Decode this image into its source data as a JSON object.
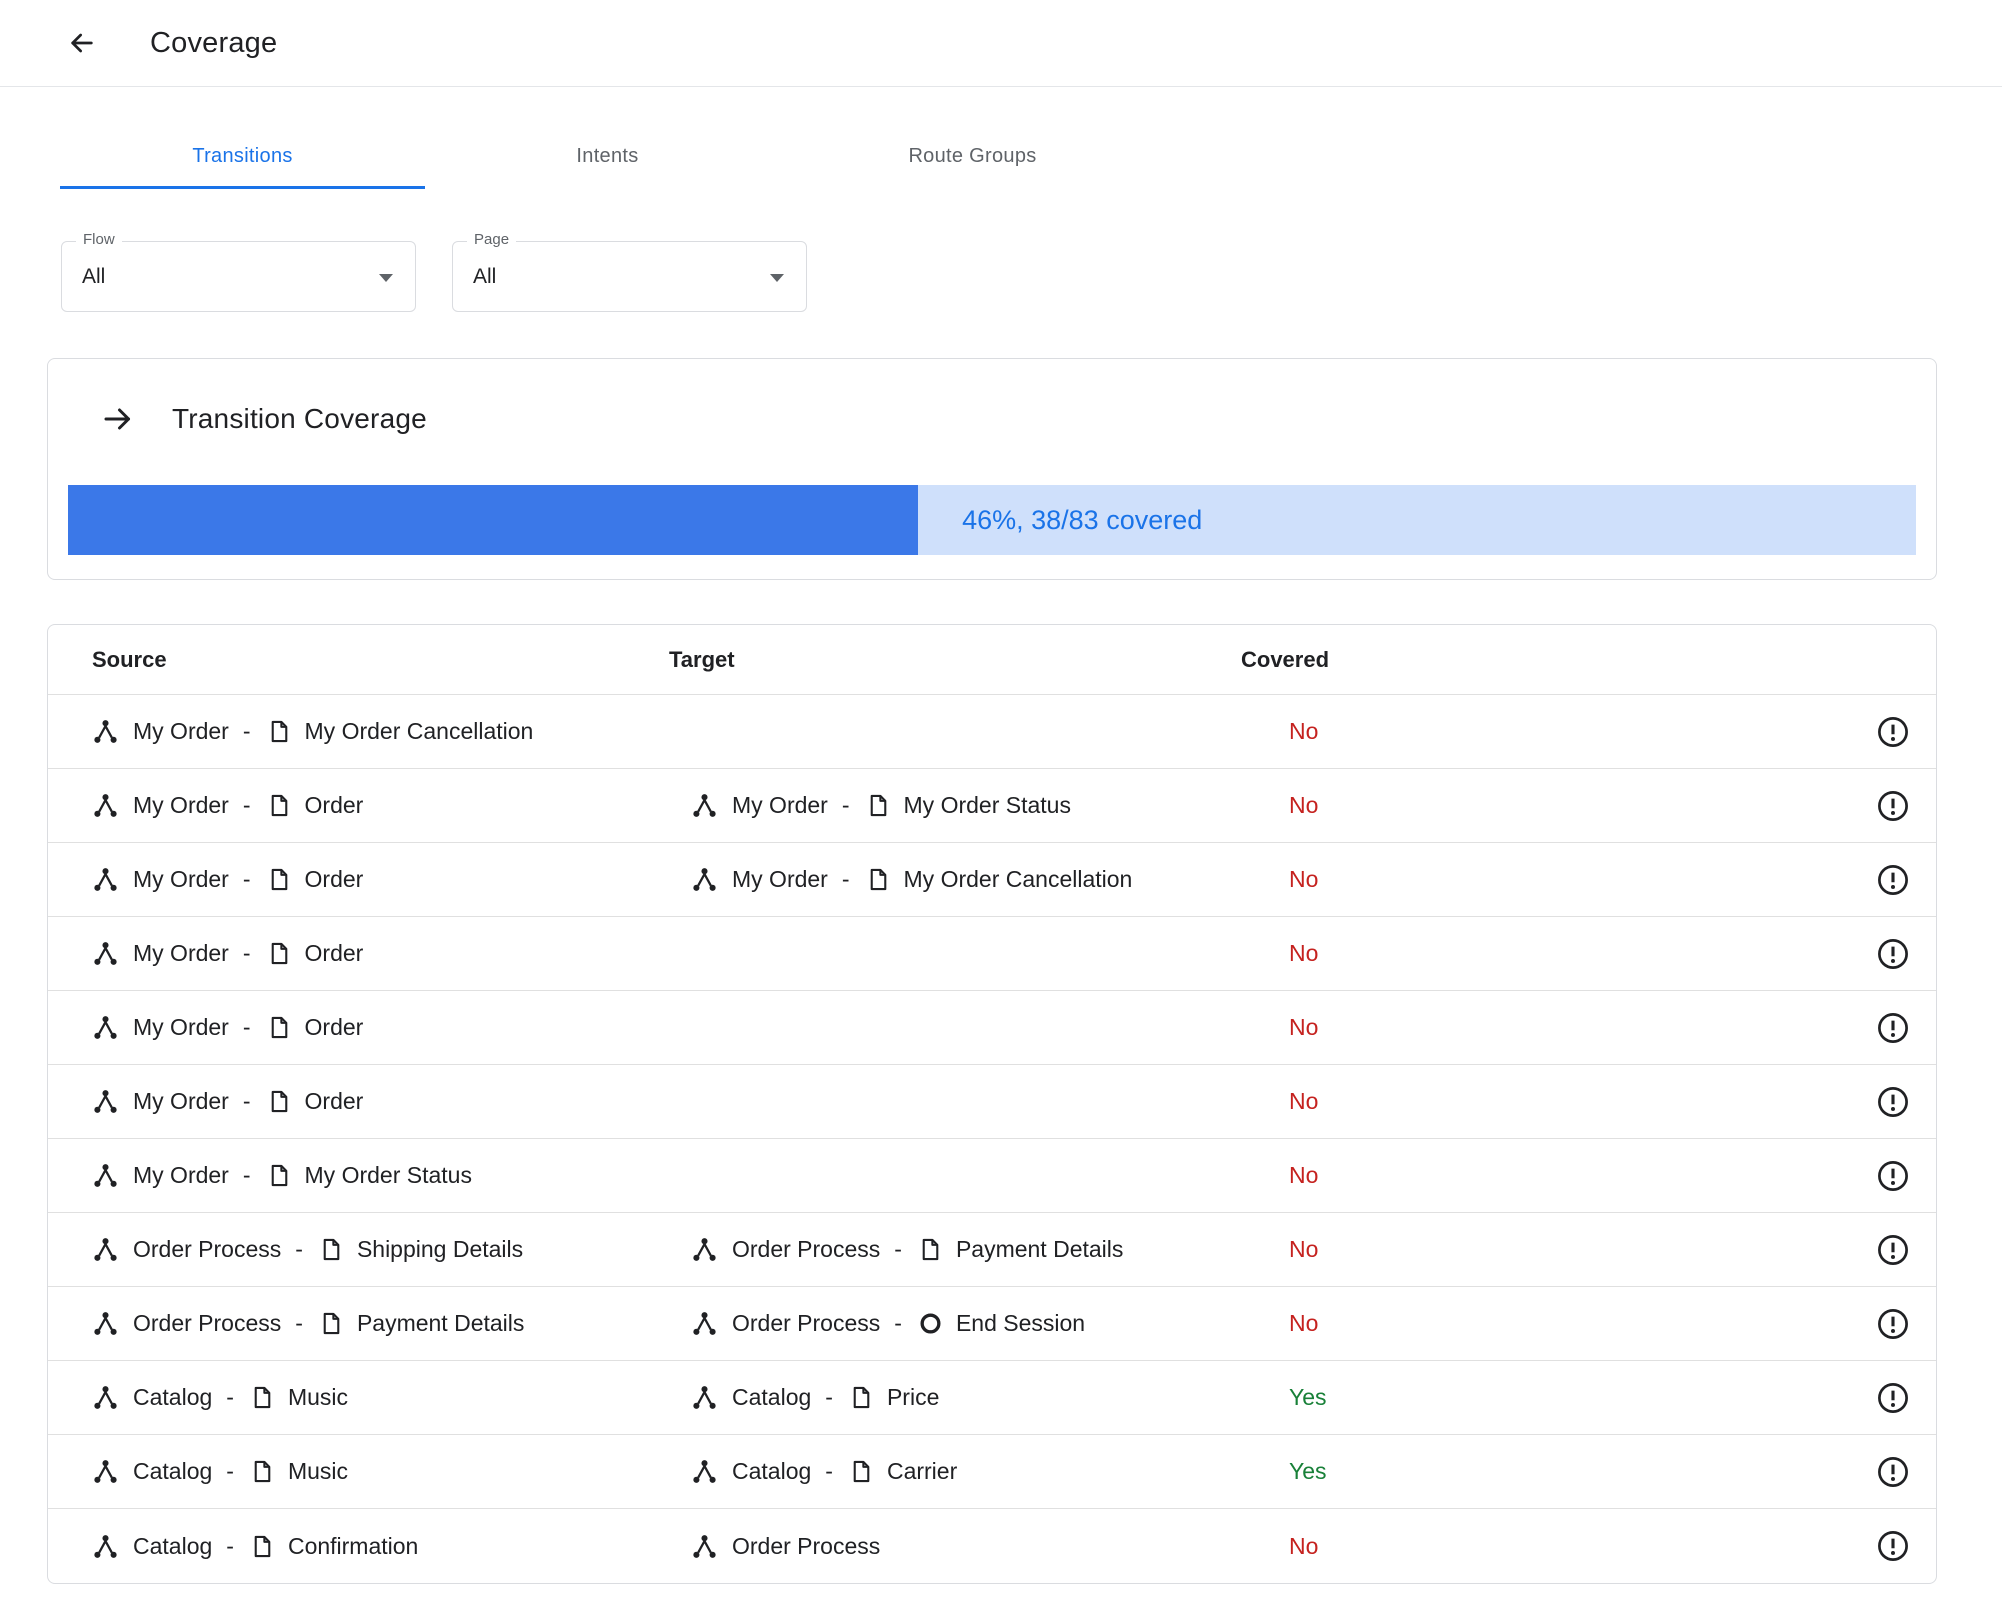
{
  "header": {
    "title": "Coverage"
  },
  "tabs": [
    {
      "label": "Transitions",
      "active": true
    },
    {
      "label": "Intents",
      "active": false
    },
    {
      "label": "Route Groups",
      "active": false
    }
  ],
  "filters": [
    {
      "label": "Flow",
      "value": "All"
    },
    {
      "label": "Page",
      "value": "All"
    }
  ],
  "coverage_card": {
    "title": "Transition Coverage",
    "progress_percent": 46,
    "progress_label": "46%, 38/83 covered"
  },
  "table": {
    "columns": [
      "Source",
      "Target",
      "Covered"
    ],
    "separator": "-",
    "rows": [
      {
        "source": {
          "flow": "My Order",
          "page": "My Order Cancellation"
        },
        "target": null,
        "covered": "No"
      },
      {
        "source": {
          "flow": "My Order",
          "page": "Order"
        },
        "target": {
          "flow": "My Order",
          "page": "My Order Status"
        },
        "covered": "No"
      },
      {
        "source": {
          "flow": "My Order",
          "page": "Order"
        },
        "target": {
          "flow": "My Order",
          "page": "My Order Cancellation"
        },
        "covered": "No"
      },
      {
        "source": {
          "flow": "My Order",
          "page": "Order"
        },
        "target": null,
        "covered": "No"
      },
      {
        "source": {
          "flow": "My Order",
          "page": "Order"
        },
        "target": null,
        "covered": "No"
      },
      {
        "source": {
          "flow": "My Order",
          "page": "Order"
        },
        "target": null,
        "covered": "No"
      },
      {
        "source": {
          "flow": "My Order",
          "page": "My Order Status"
        },
        "target": null,
        "covered": "No"
      },
      {
        "source": {
          "flow": "Order Process",
          "page": "Shipping Details"
        },
        "target": {
          "flow": "Order Process",
          "page": "Payment Details"
        },
        "covered": "No"
      },
      {
        "source": {
          "flow": "Order Process",
          "page": "Payment Details"
        },
        "target": {
          "flow": "Order Process",
          "page": "End Session",
          "icon": "end-session"
        },
        "covered": "No"
      },
      {
        "source": {
          "flow": "Catalog",
          "page": "Music"
        },
        "target": {
          "flow": "Catalog",
          "page": "Price"
        },
        "covered": "Yes"
      },
      {
        "source": {
          "flow": "Catalog",
          "page": "Music"
        },
        "target": {
          "flow": "Catalog",
          "page": "Carrier"
        },
        "covered": "Yes"
      },
      {
        "source": {
          "flow": "Catalog",
          "page": "Confirmation"
        },
        "target": {
          "flow": "Order Process",
          "page": null
        },
        "covered": "No"
      }
    ]
  },
  "colors": {
    "accent": "#1a73e8",
    "progress_fill": "#3b78e8",
    "progress_track": "#cfe0fb",
    "covered_no": "#c5221f",
    "covered_yes": "#188038"
  }
}
